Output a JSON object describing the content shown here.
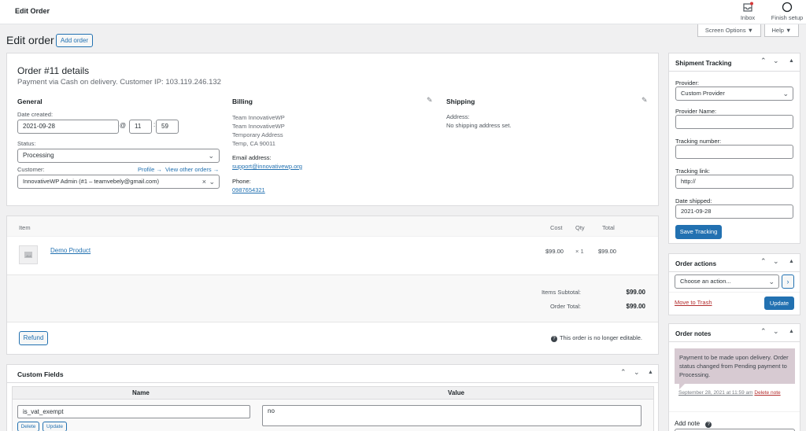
{
  "topbar": {
    "title": "Edit Order",
    "inbox_label": "Inbox",
    "finish_setup_label": "Finish setup"
  },
  "header": {
    "title": "Edit order",
    "add_order": "Add order",
    "screen_options": "Screen Options",
    "help": "Help"
  },
  "order": {
    "title": "Order #11 details",
    "subtitle": "Payment via Cash on delivery. Customer IP: 103.119.246.132",
    "general": {
      "heading": "General",
      "date_label": "Date created:",
      "date_value": "2021-09-28",
      "at": "@",
      "hour": "11",
      "minute": "59",
      "status_label": "Status:",
      "status_value": "Processing",
      "customer_label": "Customer:",
      "profile_link": "Profile →",
      "other_orders_link": "View other orders →",
      "customer_value": "InnovativeWP Admin (#1 – teamvebely@gmail.com)"
    },
    "billing": {
      "heading": "Billing",
      "lines": [
        "Team InnovativeWP",
        "Team InnovativeWP",
        "Temporary Address",
        "Temp, CA 90011"
      ],
      "email_label": "Email address:",
      "email": "support@innovativewp.org",
      "phone_label": "Phone:",
      "phone": "0987654321"
    },
    "shipping": {
      "heading": "Shipping",
      "address_label": "Address:",
      "address_value": "No shipping address set."
    }
  },
  "items": {
    "col_item": "Item",
    "col_cost": "Cost",
    "col_qty": "Qty",
    "col_total": "Total",
    "rows": [
      {
        "name": "Demo Product",
        "cost": "$99.00",
        "qty": "× 1",
        "total": "$99.00"
      }
    ],
    "subtotal_label": "Items Subtotal:",
    "subtotal_value": "$99.00",
    "order_total_label": "Order Total:",
    "order_total_value": "$99.00",
    "refund": "Refund",
    "not_editable": "This order is no longer editable."
  },
  "custom_fields": {
    "title": "Custom Fields",
    "col_name": "Name",
    "col_value": "Value",
    "row_name": "is_vat_exempt",
    "row_value": "no",
    "delete": "Delete",
    "update": "Update"
  },
  "tracking": {
    "title": "Shipment Tracking",
    "provider_label": "Provider:",
    "provider_value": "Custom Provider",
    "provider_name_label": "Provider Name:",
    "tracking_number_label": "Tracking number:",
    "tracking_link_label": "Tracking link:",
    "tracking_link_value": "http://",
    "date_shipped_label": "Date shipped:",
    "date_shipped_value": "2021-09-28",
    "save": "Save Tracking"
  },
  "actions": {
    "title": "Order actions",
    "select_value": "Choose an action...",
    "trash": "Move to Trash",
    "update": "Update"
  },
  "notes": {
    "title": "Order notes",
    "note_text": "Payment to be made upon delivery. Order status changed from Pending payment to Processing.",
    "note_meta": "September 28, 2021 at 11:59 am",
    "delete_note": "Delete note",
    "add_note": "Add note"
  }
}
